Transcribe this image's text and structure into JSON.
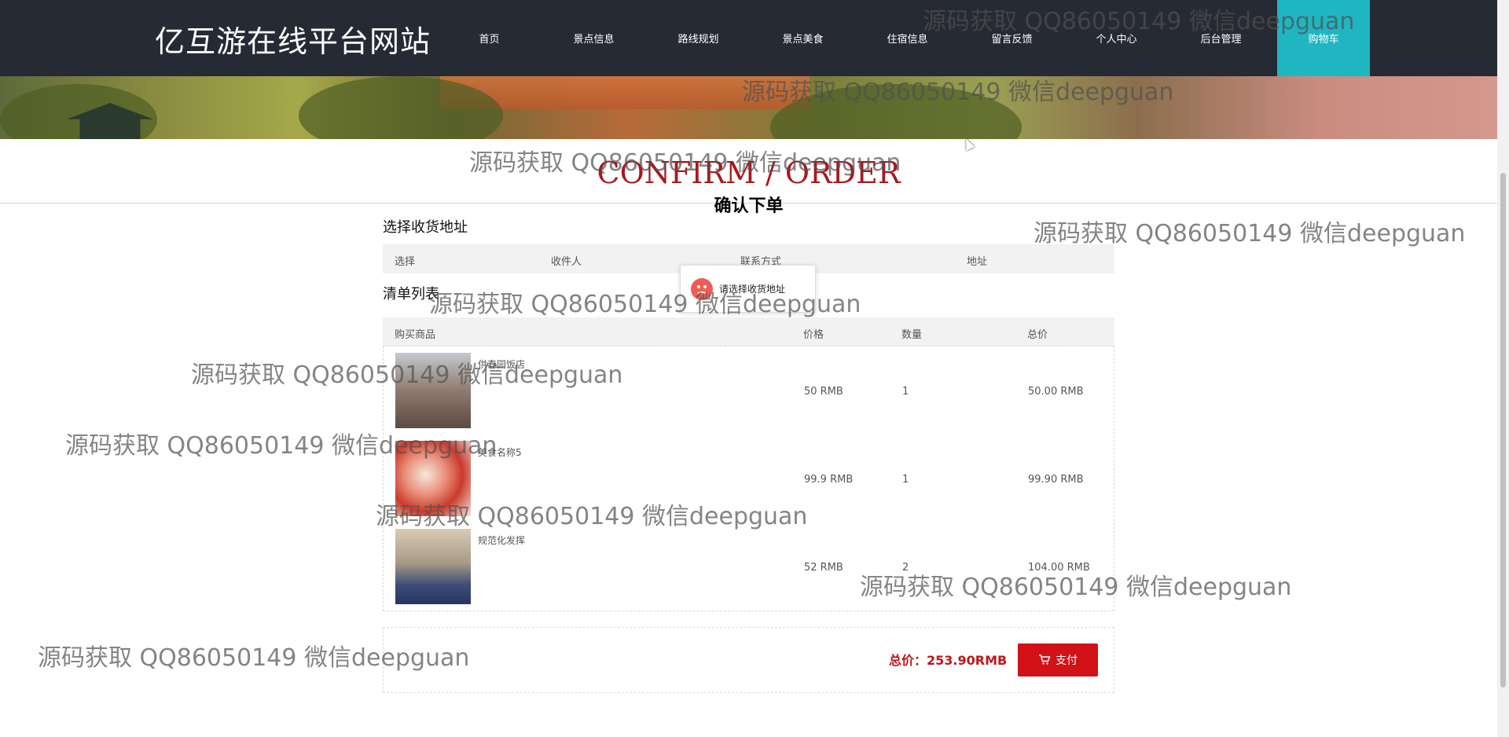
{
  "site_title": "亿互游在线平台网站",
  "nav": [
    {
      "label": "首页"
    },
    {
      "label": "景点信息"
    },
    {
      "label": "路线规划"
    },
    {
      "label": "景点美食"
    },
    {
      "label": "住宿信息"
    },
    {
      "label": "留言反馈"
    },
    {
      "label": "个人中心"
    },
    {
      "label": "后台管理"
    },
    {
      "label": "购物车",
      "active": true
    }
  ],
  "heading": {
    "en": "CONFIRM / ORDER",
    "cn": "确认下单"
  },
  "address": {
    "section_title": "选择收货地址",
    "columns": [
      "选择",
      "收件人",
      "联系方式",
      "地址"
    ]
  },
  "toast": {
    "message": "请选择收货地址",
    "icon": "sad-face-icon"
  },
  "order": {
    "section_title": "清单列表",
    "columns": [
      "购买商品",
      "价格",
      "数量",
      "总价"
    ],
    "items": [
      {
        "name": "供春园饭店",
        "price": "50 RMB",
        "qty": "1",
        "total": "50.00 RMB"
      },
      {
        "name": "美食名称5",
        "price": "99.9 RMB",
        "qty": "1",
        "total": "99.90 RMB"
      },
      {
        "name": "规范化发挥",
        "price": "52 RMB",
        "qty": "2",
        "total": "104.00 RMB"
      }
    ]
  },
  "summary": {
    "total_label": "总价：253.90RMB",
    "pay_label": "支付",
    "pay_icon": "cart-icon"
  },
  "watermark": "源码获取 QQ86050149 微信deepguan",
  "colors": {
    "header_bg": "#262a34",
    "active_nav": "#1fb6c1",
    "accent_red": "#d21216"
  }
}
